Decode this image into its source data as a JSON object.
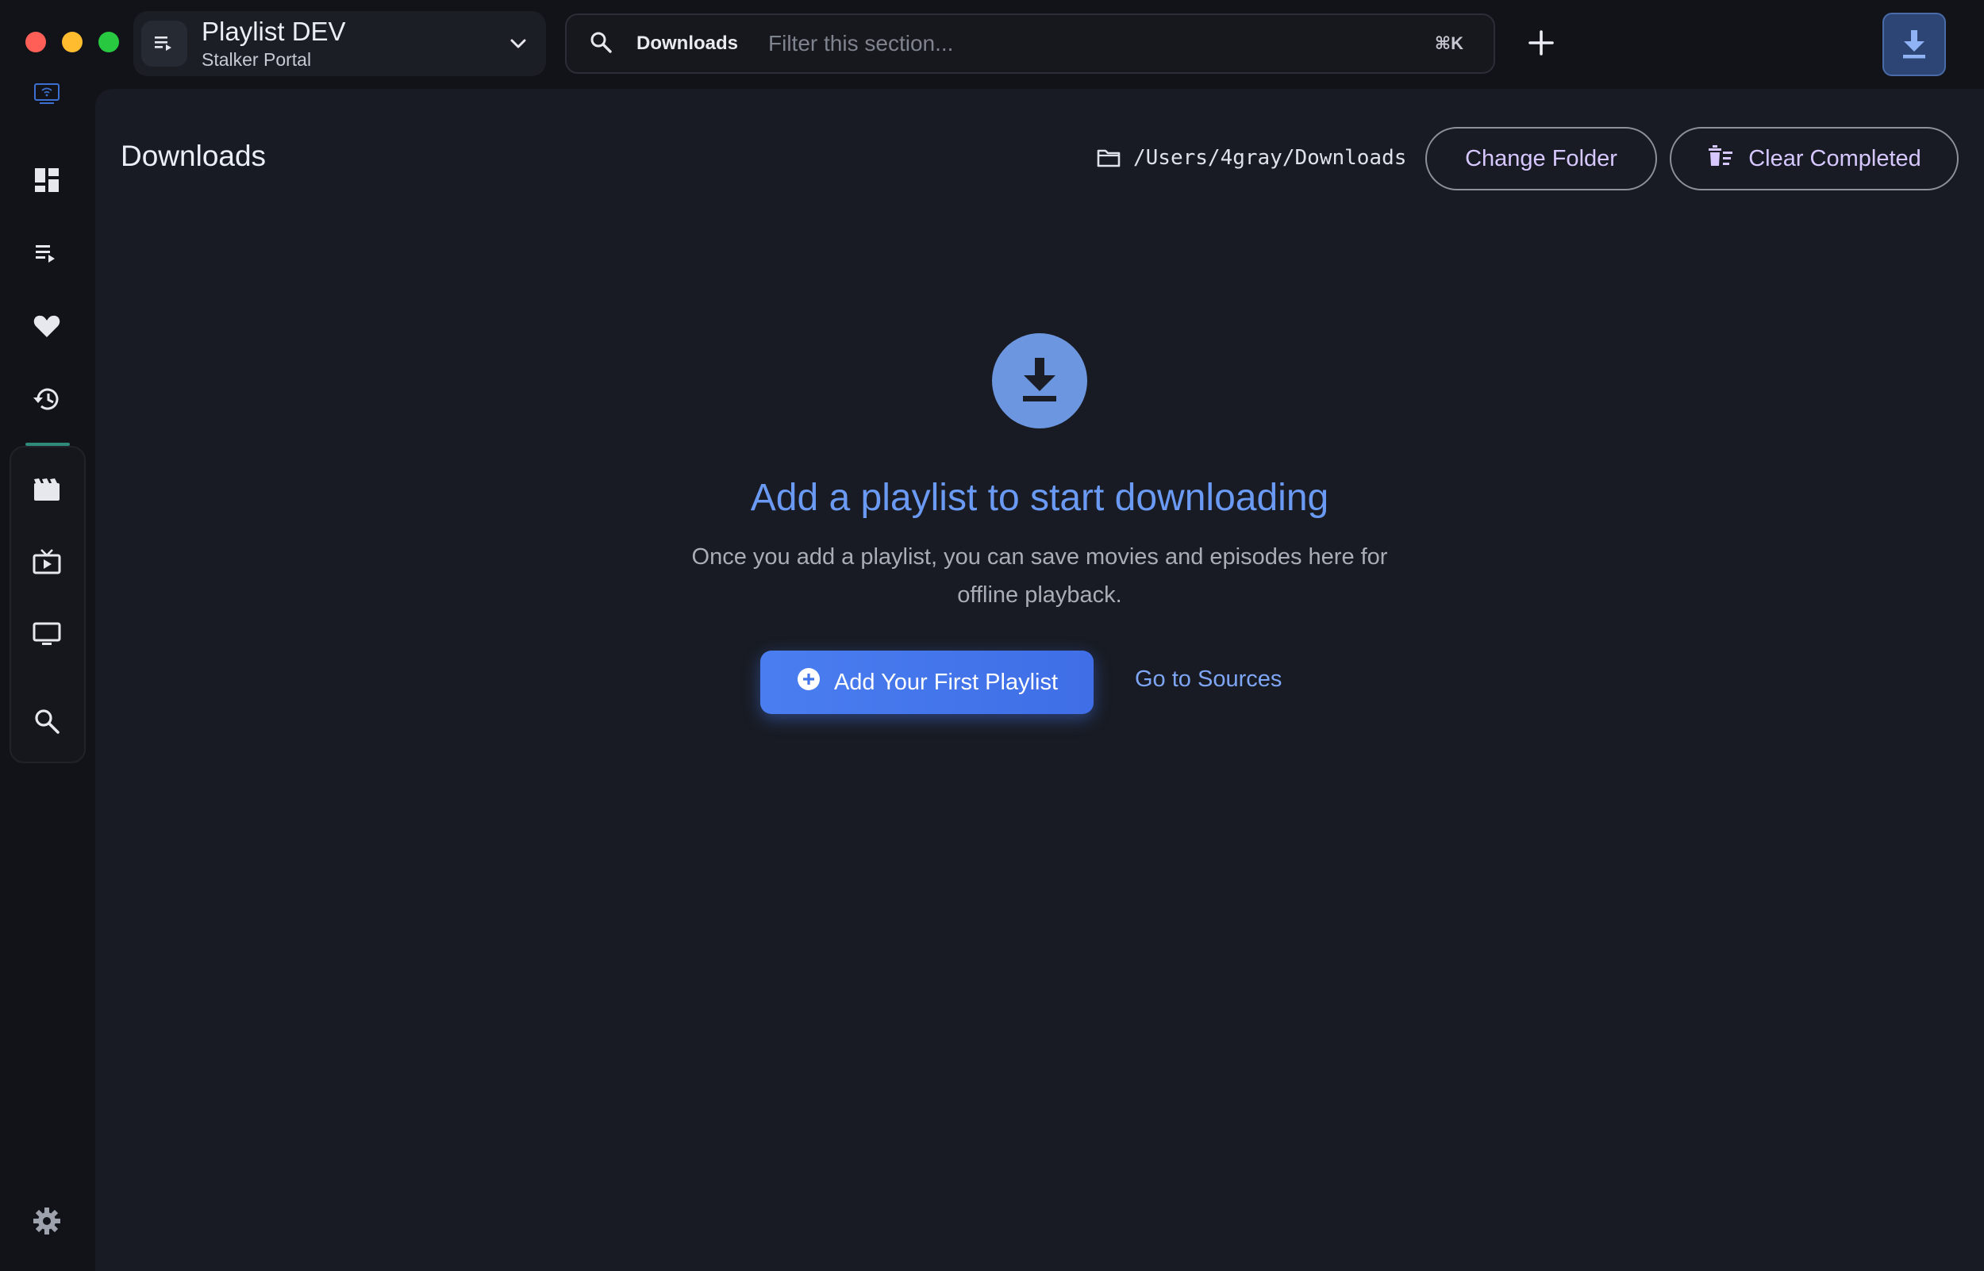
{
  "window": {
    "traffic_lights": [
      "close",
      "minimize",
      "maximize"
    ]
  },
  "playlist_switcher": {
    "title": "Playlist DEV",
    "subtitle": "Stalker Portal"
  },
  "search": {
    "scope": "Downloads",
    "placeholder": "Filter this section...",
    "shortcut": "⌘K"
  },
  "sidebar": {
    "items": [
      {
        "icon": "dashboard-icon"
      },
      {
        "icon": "playlist-icon"
      },
      {
        "icon": "heart-icon"
      },
      {
        "icon": "history-icon"
      },
      {
        "icon": "movies-icon"
      },
      {
        "icon": "tv-series-icon"
      },
      {
        "icon": "live-tv-icon"
      },
      {
        "icon": "search-icon"
      },
      {
        "icon": "settings-icon"
      }
    ]
  },
  "main": {
    "title": "Downloads",
    "folder_path": "/Users/4gray/Downloads",
    "change_folder_label": "Change Folder",
    "clear_completed_label": "Clear Completed",
    "empty_state": {
      "title": "Add a playlist to start downloading",
      "description": "Once you add a playlist, you can save movies and episodes here for offline playback.",
      "primary_action": "Add Your First Playlist",
      "secondary_action": "Go to Sources"
    }
  },
  "colors": {
    "accent": "#4a7ef0",
    "link": "#7ea6f5",
    "outline_button_text": "#d6c7ff",
    "background": "#181b23"
  }
}
